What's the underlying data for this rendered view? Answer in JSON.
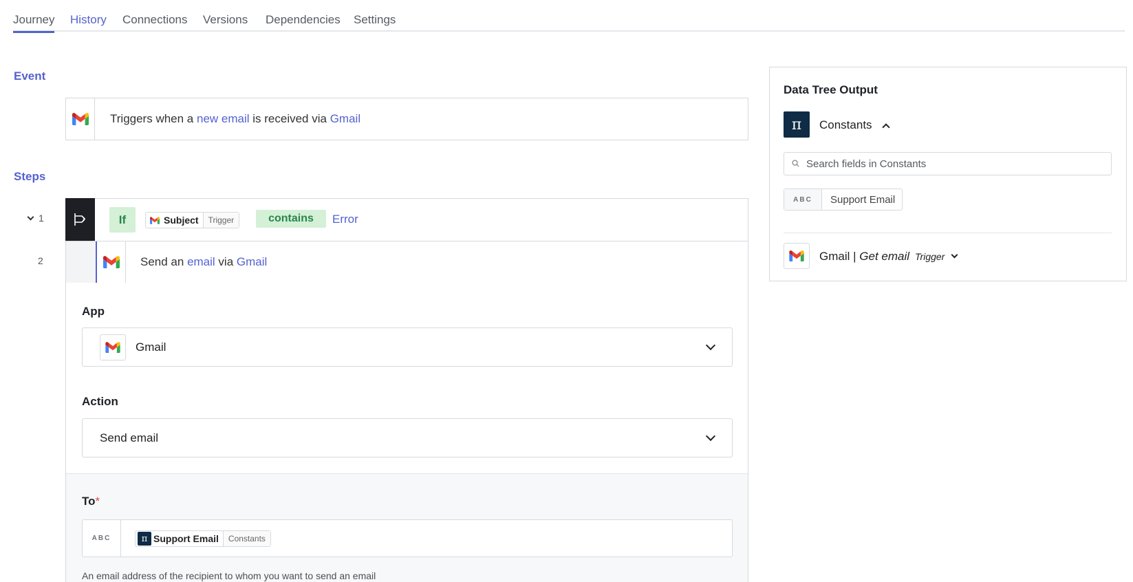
{
  "tabs": [
    {
      "label": "Journey"
    },
    {
      "label": "History"
    },
    {
      "label": "Connections"
    },
    {
      "label": "Versions"
    },
    {
      "label": "Dependencies"
    },
    {
      "label": "Settings"
    }
  ],
  "event": {
    "section_label": "Event",
    "text_before": "Triggers when a ",
    "link1": "new email",
    "text_mid": " is received via ",
    "link2": "Gmail",
    "icon": "gmail-icon"
  },
  "steps": {
    "section_label": "Steps",
    "step1": {
      "number": "1",
      "icon": "branch-icon",
      "if_label": "If",
      "field_label": "Subject",
      "field_tag": "Trigger",
      "operator": "contains",
      "value": "Error"
    },
    "step2": {
      "number": "2",
      "text_before": "Send an ",
      "link1": "email",
      "text_mid": " via ",
      "link2": "Gmail",
      "icon": "gmail-icon"
    }
  },
  "config": {
    "app_label": "App",
    "app_value": "Gmail",
    "action_label": "Action",
    "action_value": "Send email",
    "to_label": "To",
    "to_required": "*",
    "to_type": "ABC",
    "to_chip_label": "Support Email",
    "to_chip_tag": "Constants",
    "to_hint": "An email address of the recipient to whom you want to send an email"
  },
  "panel": {
    "title": "Data Tree Output",
    "constants_label": "Constants",
    "pi_symbol": "π",
    "search_placeholder": "Search fields in Constants",
    "field_type": "ABC",
    "field_label": "Support Email",
    "gmail_app": "Gmail",
    "gmail_sep": " | ",
    "gmail_action": "Get email",
    "gmail_tag": "Trigger"
  },
  "colors": {
    "accent": "#5562cf",
    "green_bg": "#d4f0d6",
    "green_text": "#27864a",
    "dark": "#1d1f24",
    "constants_bg": "#0f2b45"
  }
}
